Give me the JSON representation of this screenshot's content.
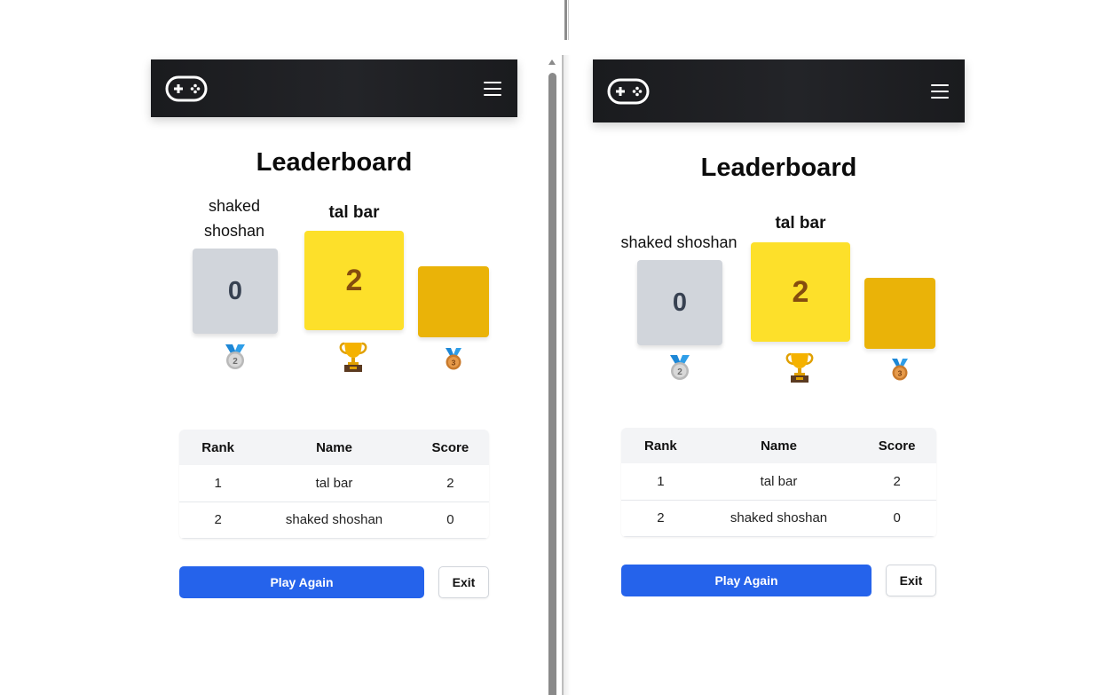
{
  "left_panel": {
    "title": "Leaderboard",
    "podium": {
      "second": {
        "name": "shaked shoshan",
        "score": "0",
        "medal": "2nd-place-medal"
      },
      "first": {
        "name": "tal bar",
        "score": "2",
        "medal": "trophy"
      },
      "third": {
        "name": "",
        "score": "",
        "medal": "3rd-place-medal"
      }
    },
    "table": {
      "headers": [
        "Rank",
        "Name",
        "Score"
      ],
      "rows": [
        {
          "rank": "1",
          "name": "tal bar",
          "score": "2"
        },
        {
          "rank": "2",
          "name": "shaked shoshan",
          "score": "0"
        }
      ]
    },
    "play_again_label": "Play Again",
    "exit_label": "Exit"
  },
  "right_panel": {
    "title": "Leaderboard",
    "podium": {
      "second": {
        "name": "shaked shoshan",
        "score": "0",
        "medal": "2nd-place-medal"
      },
      "first": {
        "name": "tal bar",
        "score": "2",
        "medal": "trophy"
      },
      "third": {
        "name": "",
        "score": "",
        "medal": "3rd-place-medal"
      }
    },
    "table": {
      "headers": [
        "Rank",
        "Name",
        "Score"
      ],
      "rows": [
        {
          "rank": "1",
          "name": "tal bar",
          "score": "2"
        },
        {
          "rank": "2",
          "name": "shaked shoshan",
          "score": "0"
        }
      ]
    },
    "play_again_label": "Play Again",
    "exit_label": "Exit"
  },
  "icons": {
    "logo": "gamepad-icon",
    "menu": "hamburger-menu-icon"
  },
  "colors": {
    "navbar": "#1f2023",
    "silver_block": "#d1d5db",
    "gold_block": "#fde02a",
    "bronze_block": "#eab308",
    "primary_button": "#2563eb"
  }
}
